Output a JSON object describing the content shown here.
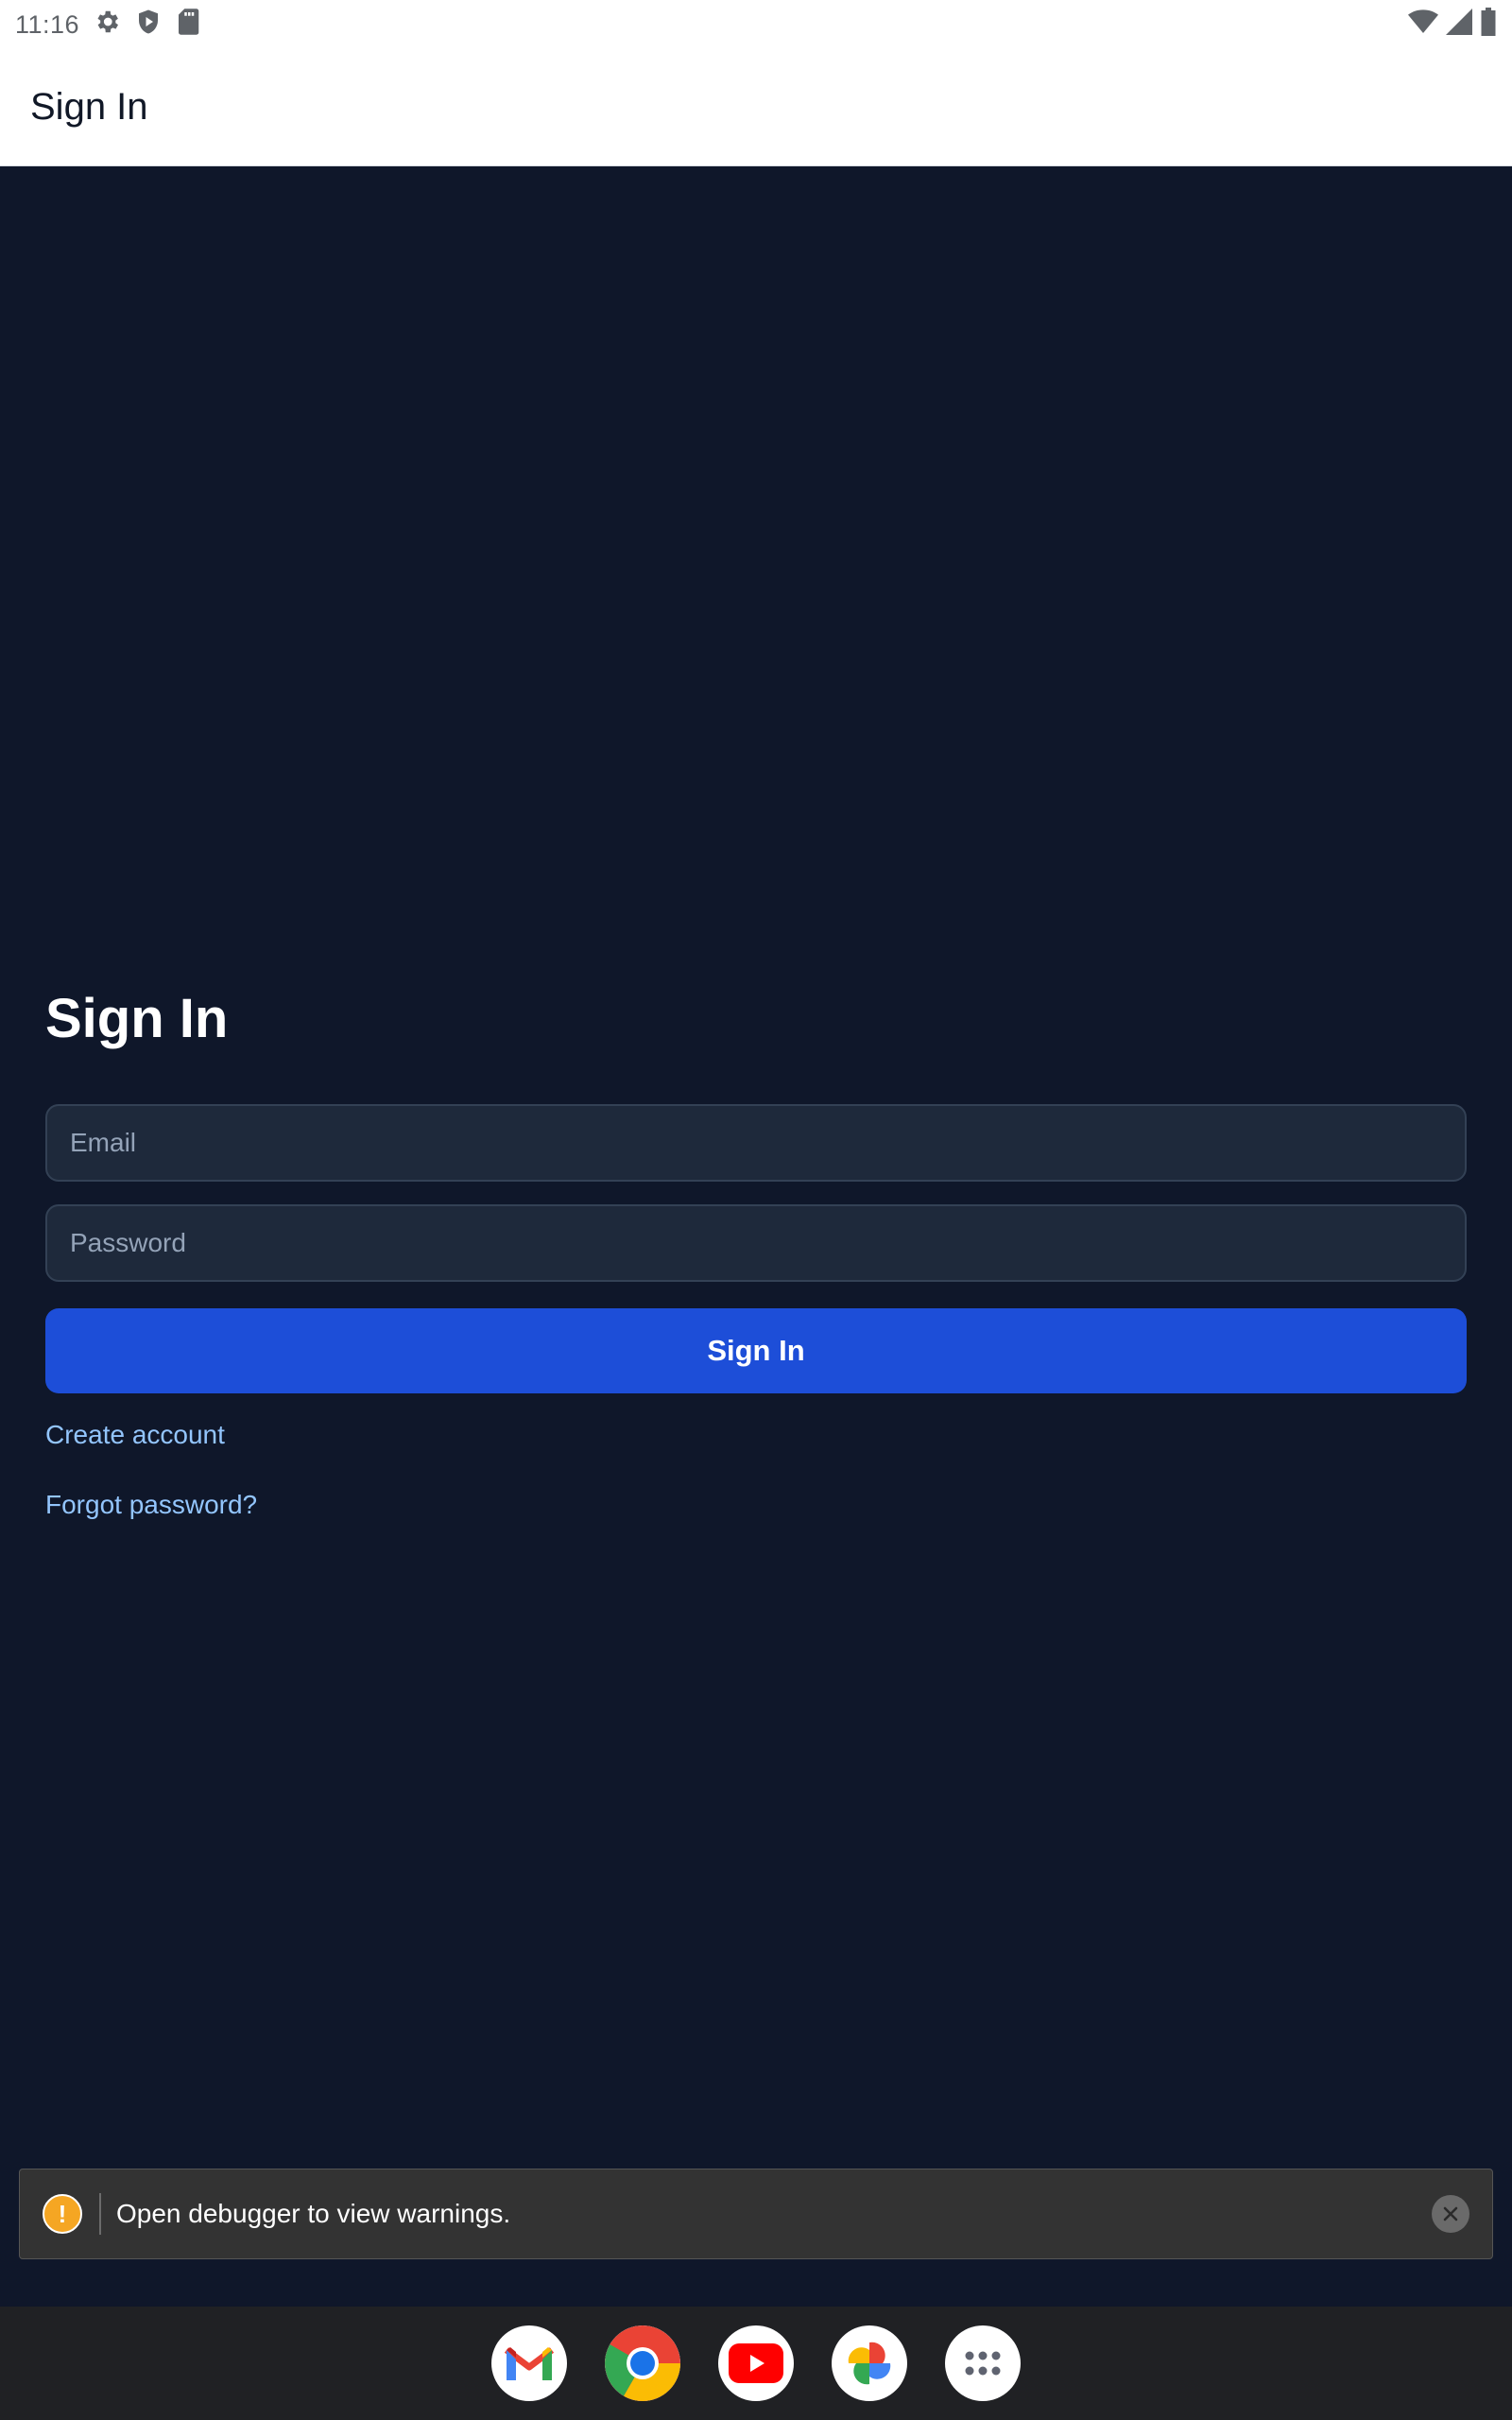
{
  "status_bar": {
    "time": "11:16",
    "left_icons": [
      "settings-icon",
      "shield-icon",
      "sd-card-icon"
    ],
    "right_icons": [
      "wifi-icon",
      "signal-icon",
      "battery-icon"
    ]
  },
  "app_bar": {
    "title": "Sign In"
  },
  "form": {
    "title": "Sign In",
    "email_placeholder": "Email",
    "password_placeholder": "Password",
    "submit_label": "Sign In",
    "create_account_label": "Create account",
    "forgot_password_label": "Forgot password?"
  },
  "toast": {
    "message": "Open debugger to view warnings.",
    "icon": "warning-icon"
  },
  "dock": {
    "apps": [
      "gmail-icon",
      "chrome-icon",
      "youtube-icon",
      "photos-icon",
      "app-drawer-icon"
    ]
  },
  "colors": {
    "background": "#0f172a",
    "input_bg": "#1e293b",
    "primary": "#1d4ed8",
    "link": "#93c5fd"
  }
}
